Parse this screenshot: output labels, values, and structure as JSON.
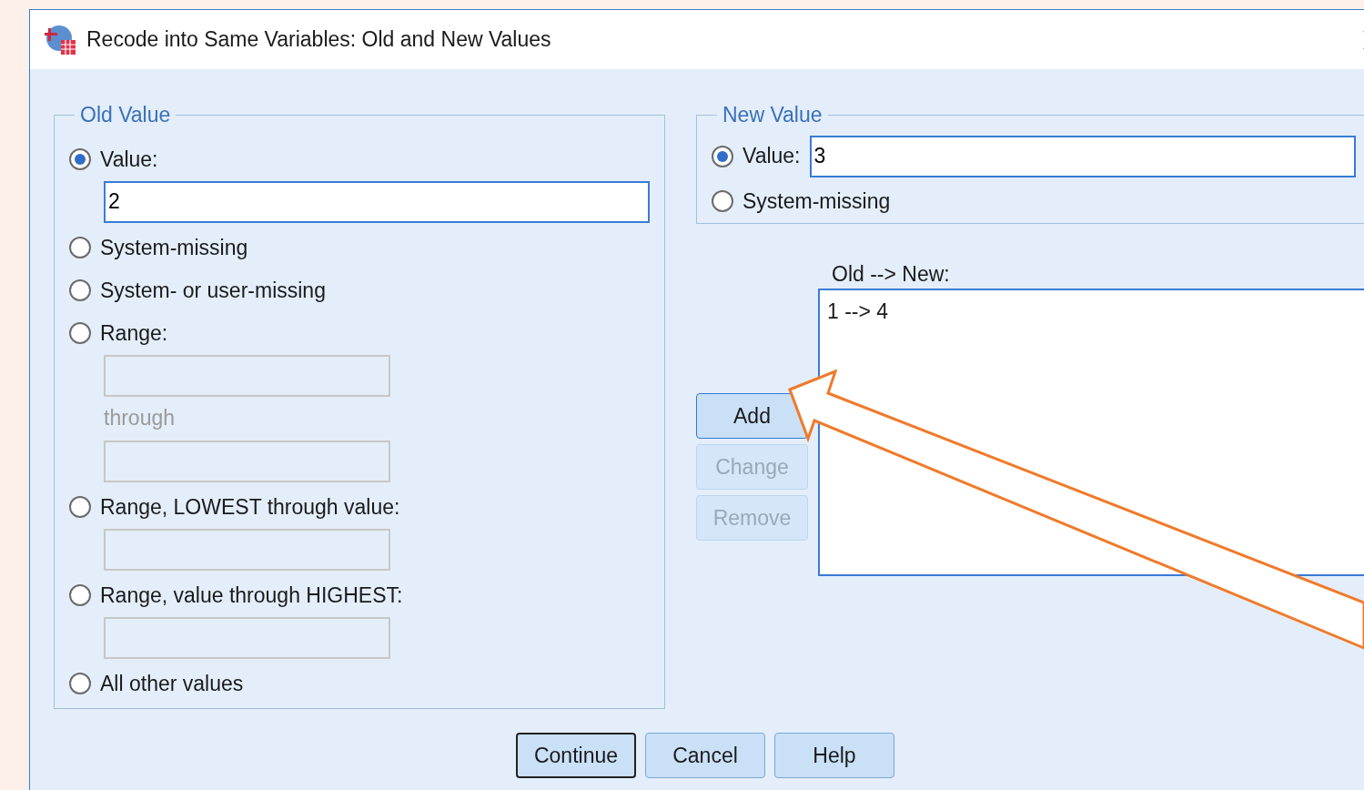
{
  "window": {
    "title": "Recode into Same Variables: Old and New Values"
  },
  "old_value": {
    "legend": "Old Value",
    "options": [
      {
        "kind": "field",
        "label": "Value:",
        "selected": true,
        "fields": [
          {
            "value": "2",
            "enabled": true
          }
        ]
      },
      {
        "kind": "plain",
        "label": "System-missing",
        "selected": false
      },
      {
        "kind": "plain",
        "label": "System- or user-missing",
        "selected": false
      },
      {
        "kind": "range",
        "label": "Range:",
        "selected": false,
        "fields": [
          {
            "enabled": false
          },
          {
            "enabled": false
          }
        ],
        "through": "through"
      },
      {
        "kind": "field",
        "label": "Range, LOWEST through value:",
        "selected": false,
        "fields": [
          {
            "enabled": false
          }
        ]
      },
      {
        "kind": "field",
        "label": "Range, value through HIGHEST:",
        "selected": false,
        "fields": [
          {
            "enabled": false
          }
        ]
      },
      {
        "kind": "plain",
        "label": "All other values",
        "selected": false
      }
    ]
  },
  "new_value": {
    "legend": "New Value",
    "options": [
      {
        "kind": "field",
        "label": "Value:",
        "selected": true,
        "fields": [
          {
            "value": "3",
            "enabled": true
          }
        ]
      },
      {
        "kind": "plain",
        "label": "System-missing",
        "selected": false
      }
    ]
  },
  "mapping": {
    "label": "Old --> New:",
    "items": [
      "1 --> 4"
    ]
  },
  "side_buttons": [
    {
      "label": "Add",
      "disabled": false,
      "hovered": true
    },
    {
      "label": "Change",
      "disabled": true,
      "hovered": false
    },
    {
      "label": "Remove",
      "disabled": true,
      "hovered": false
    }
  ],
  "buttons": [
    {
      "label": "Continue",
      "focused": true
    },
    {
      "label": "Cancel",
      "focused": false
    },
    {
      "label": "Help",
      "focused": false
    }
  ]
}
